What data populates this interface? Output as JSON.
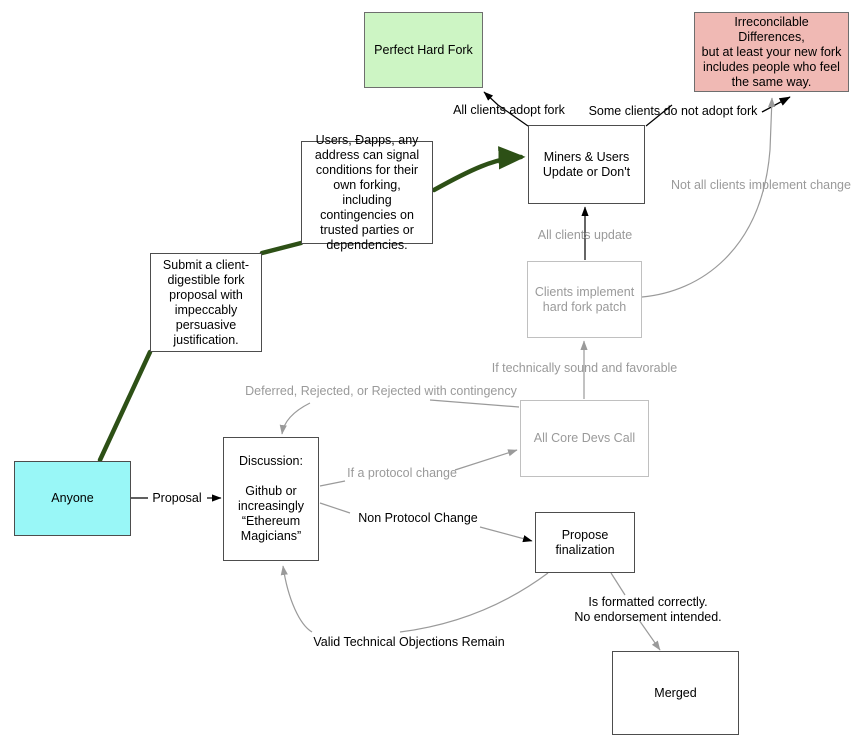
{
  "diagram": {
    "title": "Ethereum Hard Fork Proposal Process",
    "colors": {
      "green_fill": "#cdf5c4",
      "cyan_fill": "#99f7f7",
      "pink_fill": "#f0b9b4",
      "dark_green_arrow": "#2d5016",
      "muted_gray": "#9a9a9a",
      "black": "#000000",
      "white": "#ffffff"
    },
    "nodes": [
      {
        "id": "perfect-hard-fork",
        "label": "Perfect Hard Fork",
        "style": "green"
      },
      {
        "id": "irreconcilable-differences",
        "label": "Irreconcilable Differences,\nbut at least your new fork\nincludes people who feel\nthe same way.",
        "style": "pink"
      },
      {
        "id": "users-dapps-signal",
        "label": "Users, Ðapps, any\naddress can signal\nconditions for their\nown forking, including\ncontingencies on\ntrusted parties or\ndependencies.",
        "style": "strong"
      },
      {
        "id": "miners-users-update",
        "label": "Miners & Users\nUpdate or Don't",
        "style": "strong"
      },
      {
        "id": "submit-fork-proposal",
        "label": "Submit a client-\ndigestible fork\nproposal with\nimpeccably\npersuasive\njustification.",
        "style": "strong"
      },
      {
        "id": "clients-implement-patch",
        "label": "Clients implement\nhard fork patch",
        "style": "muted"
      },
      {
        "id": "all-core-devs-call",
        "label": "All Core Devs Call",
        "style": "muted"
      },
      {
        "id": "anyone",
        "label": "Anyone",
        "style": "cyan"
      },
      {
        "id": "discussion",
        "label": "Discussion:\n\nGithub or\nincreasingly\n“Ethereum\nMagicians”",
        "style": "strong"
      },
      {
        "id": "propose-finalization",
        "label": "Propose\nfinalization",
        "style": "strong"
      },
      {
        "id": "merged",
        "label": "Merged",
        "style": "strong"
      }
    ],
    "edge_labels": [
      {
        "id": "all-clients-adopt-fork",
        "text": "All clients adopt fork",
        "tone": "black"
      },
      {
        "id": "some-clients-do-not-adopt-fork",
        "text": "Some clients do not adopt fork",
        "tone": "black"
      },
      {
        "id": "not-all-clients-implement-change",
        "text": "Not all clients implement change",
        "tone": "muted"
      },
      {
        "id": "all-clients-update",
        "text": "All clients update",
        "tone": "muted"
      },
      {
        "id": "if-technically-sound-and-favorable",
        "text": "If technically sound and favorable",
        "tone": "muted"
      },
      {
        "id": "deferred-rejected",
        "text": "Deferred, Rejected, or Rejected with contingency",
        "tone": "muted"
      },
      {
        "id": "if-a-protocol-change",
        "text": "If a protocol change",
        "tone": "muted"
      },
      {
        "id": "proposal",
        "text": "Proposal",
        "tone": "black"
      },
      {
        "id": "non-protocol-change",
        "text": "Non Protocol Change",
        "tone": "black"
      },
      {
        "id": "is-formatted-correctly",
        "text": "Is formatted correctly.\nNo endorsement intended.",
        "tone": "black"
      },
      {
        "id": "valid-technical-objections-remain",
        "text": "Valid Technical Objections Remain",
        "tone": "black"
      }
    ],
    "edges": [
      {
        "from": "miners-users-update",
        "to": "perfect-hard-fork",
        "label": "All clients adopt fork"
      },
      {
        "from": "miners-users-update",
        "to": "irreconcilable-differences",
        "label": "Some clients do not adopt fork"
      },
      {
        "from": "clients-implement-patch",
        "to": "irreconcilable-differences",
        "label": "Not all clients implement change"
      },
      {
        "from": "clients-implement-patch",
        "to": "miners-users-update",
        "label": "All clients update"
      },
      {
        "from": "all-core-devs-call",
        "to": "clients-implement-patch",
        "label": "If technically sound and favorable"
      },
      {
        "from": "all-core-devs-call",
        "to": "discussion",
        "label": "Deferred, Rejected, or Rejected with contingency"
      },
      {
        "from": "discussion",
        "to": "all-core-devs-call",
        "label": "If a protocol change"
      },
      {
        "from": "anyone",
        "to": "discussion",
        "label": "Proposal"
      },
      {
        "from": "discussion",
        "to": "propose-finalization",
        "label": "Non Protocol Change"
      },
      {
        "from": "propose-finalization",
        "to": "merged",
        "label": "Is formatted correctly. No endorsement intended."
      },
      {
        "from": "propose-finalization",
        "to": "discussion",
        "label": "Valid Technical Objections Remain"
      },
      {
        "from": "anyone",
        "to": "submit-fork-proposal",
        "label": ""
      },
      {
        "from": "submit-fork-proposal",
        "to": "users-dapps-signal",
        "label": ""
      },
      {
        "from": "users-dapps-signal",
        "to": "miners-users-update",
        "label": ""
      }
    ]
  }
}
